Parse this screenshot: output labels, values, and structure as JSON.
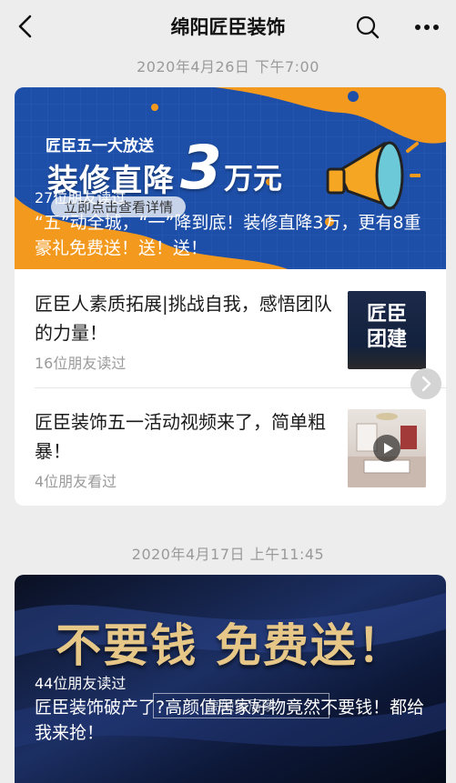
{
  "header": {
    "title": "绵阳匠臣装饰"
  },
  "groups": [
    {
      "timestamp": "2020年4月26日 下午7:00",
      "hero": {
        "promo_small": "匠臣五一大放送",
        "promo_big": "装修直降",
        "promo_number": "3",
        "promo_unit": "万元",
        "promo_button": "立即点击查看详情",
        "readers": "27位朋友读过",
        "caption": "“五”动全城，“一”降到底！装修直降3万，更有8重豪礼免费送！送！送！"
      },
      "items": [
        {
          "title": "匠臣人素质拓展|挑战自我，感悟团队的力量！",
          "readers": "16位朋友读过",
          "thumb_text": "匠臣\n团建"
        },
        {
          "title": "匠臣装饰五一活动视频来了，简单粗暴！",
          "readers": "4位朋友看过"
        }
      ]
    },
    {
      "timestamp": "2020年4月17日 上午11:45",
      "hero": {
        "banner_text": "不要钱 免费送！",
        "readers": "44位朋友读过",
        "caption": "匠臣装饰破产了?高颜值居家好物竟然不要钱！都给我来抢！",
        "watermark": "高颜值居家"
      }
    }
  ],
  "colors": {
    "background": "#ededed",
    "hero1_blue": "#1e4fa8",
    "hero1_orange": "#f39a1e",
    "hero2_dark": "#0b1326",
    "gold": "#e7c787",
    "muted_text": "#9a9a9a"
  },
  "icons": {
    "back": "chevron-left-icon",
    "search": "search-icon",
    "more": "more-dots-icon",
    "next": "chevron-right-icon",
    "play": "play-icon",
    "megaphone": "megaphone-icon"
  }
}
